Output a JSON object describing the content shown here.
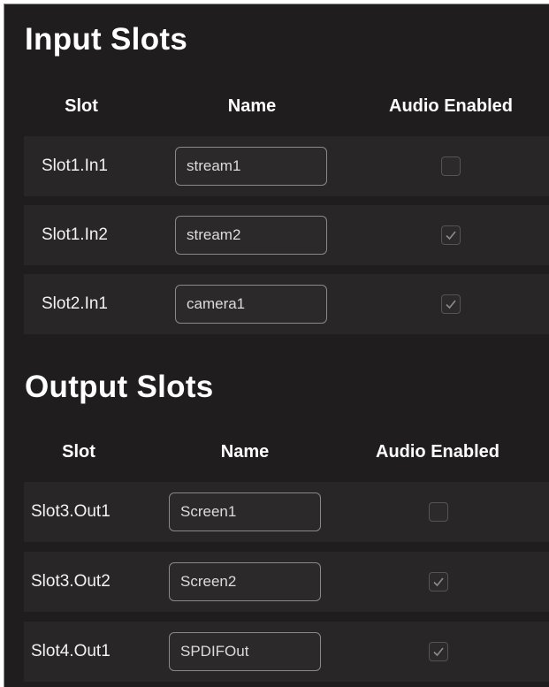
{
  "input_section": {
    "title": "Input Slots",
    "headers": {
      "slot": "Slot",
      "name": "Name",
      "audio": "Audio Enabled"
    },
    "rows": [
      {
        "slot": "Slot1.In1",
        "name": "stream1",
        "audio_enabled": false
      },
      {
        "slot": "Slot1.In2",
        "name": "stream2",
        "audio_enabled": true
      },
      {
        "slot": "Slot2.In1",
        "name": "camera1",
        "audio_enabled": true
      }
    ]
  },
  "output_section": {
    "title": "Output Slots",
    "headers": {
      "slot": "Slot",
      "name": "Name",
      "audio": "Audio Enabled"
    },
    "rows": [
      {
        "slot": "Slot3.Out1",
        "name": "Screen1",
        "audio_enabled": false
      },
      {
        "slot": "Slot3.Out2",
        "name": "Screen2",
        "audio_enabled": true
      },
      {
        "slot": "Slot4.Out1",
        "name": "SPDIFOut",
        "audio_enabled": true
      }
    ]
  },
  "colors": {
    "background": "#1f1d1d",
    "row_background": "#282626",
    "text": "#ffffff",
    "checkmark": "#8c8c8c"
  },
  "icons": {
    "checked": "checkmark-icon"
  }
}
